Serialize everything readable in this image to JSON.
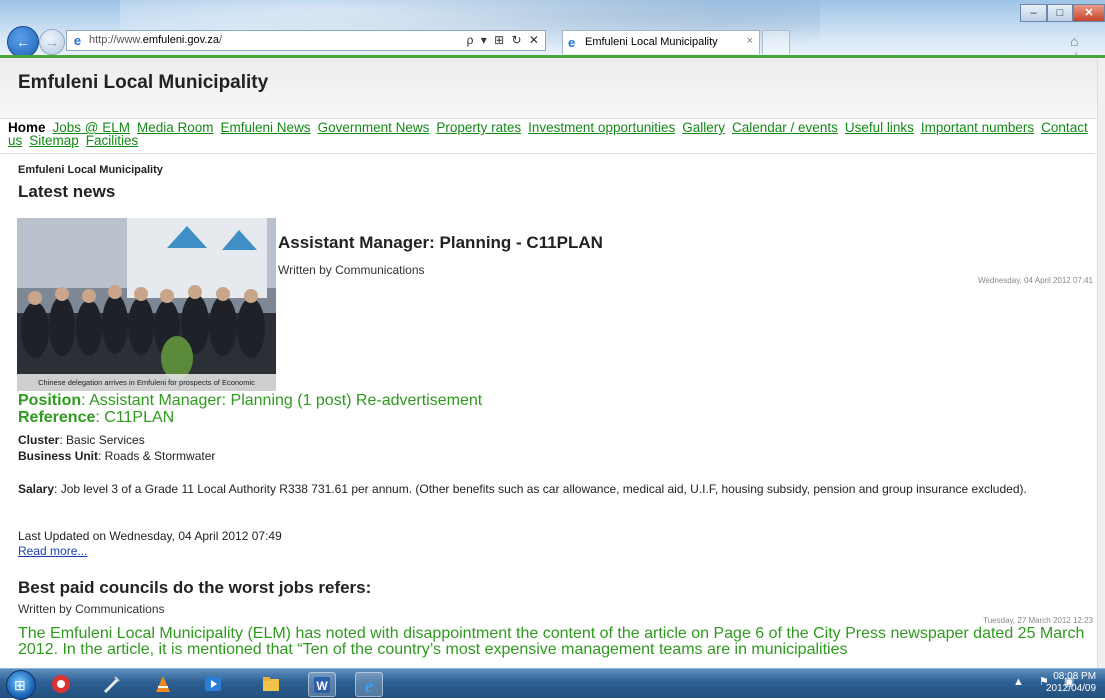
{
  "browser": {
    "url_prefix": "http://www.",
    "url_domain": "emfuleni.gov.za",
    "url_suffix": "/",
    "address_tools": "ρ ▾ ⊞ ↻ ✕",
    "tab_title": "Emfuleni Local Municipality",
    "tab_close": "×",
    "controls": {
      "minimize": "–",
      "maximize": "□",
      "close": "✕"
    },
    "right_icons": "⌂ ☆ ⚙"
  },
  "site": {
    "title": "Emfuleni Local Municipality"
  },
  "menu": {
    "home": "Home",
    "links": [
      "Jobs @ ELM",
      "Media Room",
      "Emfuleni News",
      "Government News",
      "Property rates",
      "Investment opportunities",
      "Gallery",
      "Calendar / events",
      "Useful links",
      "Important numbers",
      "Contact us",
      "Sitemap",
      "Facilities"
    ]
  },
  "breadcrumb": "Emfuleni Local Municipality",
  "section_title": "Latest news",
  "article1": {
    "image_caption": "Chinese delegation arrives in Emfuleni for prospects of Economic Cooperation",
    "title": "Assistant Manager: Planning - C11PLAN",
    "author": "Written by Communications",
    "date": "Wednesday, 04 April 2012 07:41",
    "position_label": "Position",
    "position_value": ": Assistant Manager: Planning (1 post) Re-advertisement",
    "reference_label": "Reference",
    "reference_value": ": C11PLAN",
    "cluster_label": "Cluster",
    "cluster_value": ": Basic Services",
    "unit_label": "Business Unit",
    "unit_value": ": Roads & Stormwater",
    "salary_label": "Salary",
    "salary_value": ": Job level 3 of a Grade 11 Local Authority R338 731.61 per annum.  (Other benefits such as car allowance, medical aid, U.I.F, housing subsidy, pension and group insurance excluded).",
    "last_updated": "Last Updated on Wednesday, 04 April 2012 07:49",
    "read_more": "Read more..."
  },
  "article2": {
    "title": "Best paid councils do the worst jobs refers:",
    "author": "Written by Communications",
    "date": "Tuesday, 27 March 2012 12:23",
    "body": "The Emfuleni Local Municipality (ELM) has noted with disappointment the content of the article on Page 6 of the City Press newspaper dated 25 March 2012. In the article, it is mentioned that “Ten of the country’s most expensive management teams are in municipalities"
  },
  "taskbar": {
    "time": "08:08 PM",
    "date": "2012/04/09"
  },
  "colors": {
    "link_green": "#138a16",
    "text_green": "#2e9a1e",
    "accent_line": "#4aa63a"
  }
}
